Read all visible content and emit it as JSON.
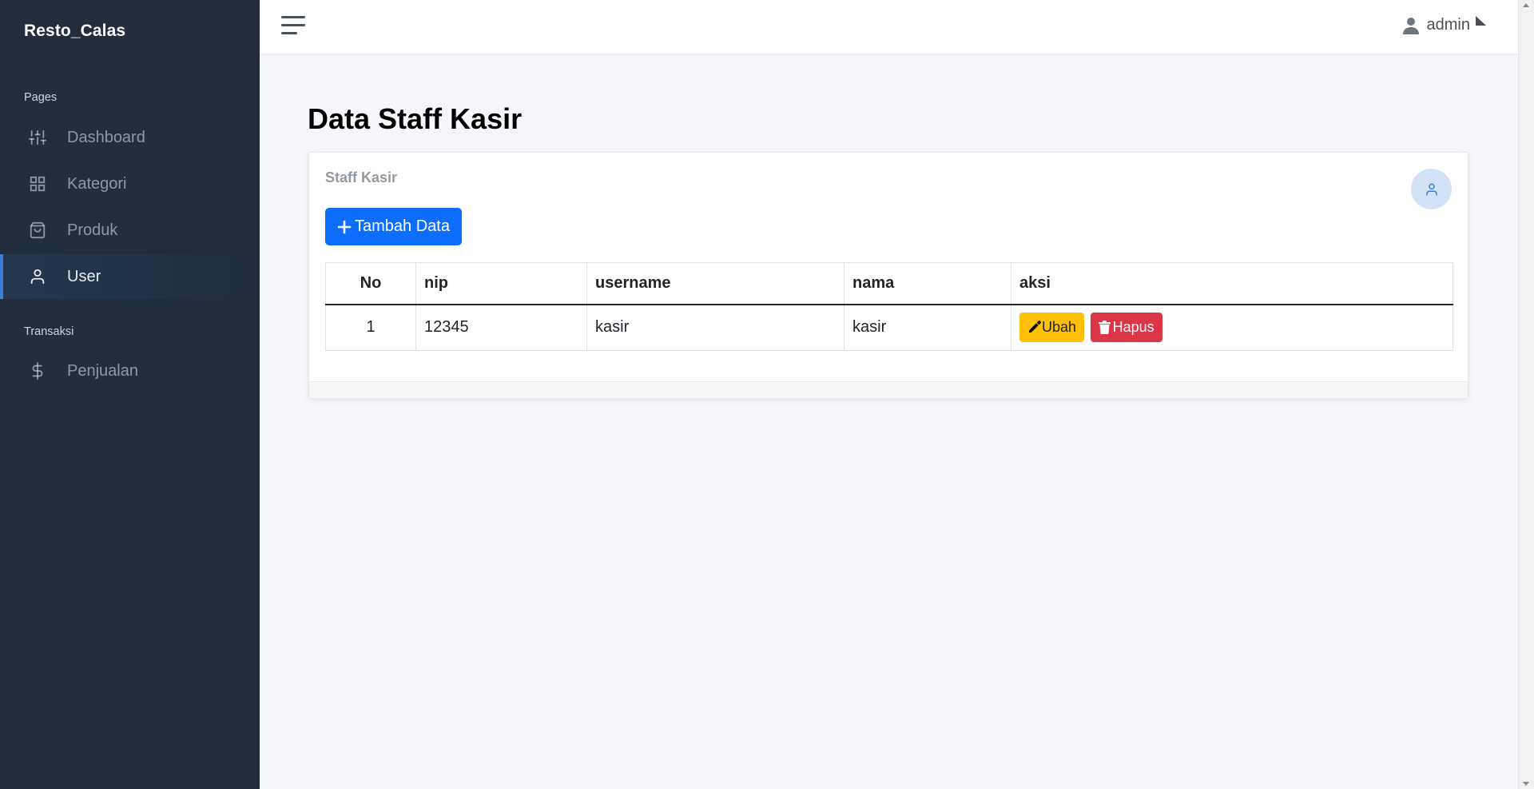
{
  "app": {
    "brand": "Resto_Calas"
  },
  "sidebar": {
    "sections": [
      {
        "header": "Pages"
      },
      {
        "header": "Transaksi"
      }
    ],
    "items": [
      {
        "label": "Dashboard",
        "icon": "sliders-icon",
        "active": false
      },
      {
        "label": "Kategori",
        "icon": "grid-icon",
        "active": false
      },
      {
        "label": "Produk",
        "icon": "shopping-bag-icon",
        "active": false
      },
      {
        "label": "User",
        "icon": "user-icon",
        "active": true
      },
      {
        "label": "Penjualan",
        "icon": "dollar-sign-icon",
        "active": false
      }
    ]
  },
  "topbar": {
    "user_name": "admin"
  },
  "page": {
    "title_bold": "Data",
    "title_rest": "Staff Kasir"
  },
  "card": {
    "title": "Staff Kasir",
    "add_button": "Tambah Data",
    "table": {
      "columns": [
        "No",
        "nip",
        "username",
        "nama",
        "aksi"
      ],
      "rows": [
        {
          "no": "1",
          "nip": "12345",
          "username": "kasir",
          "nama": "kasir",
          "edit_label": "Ubah",
          "delete_label": "Hapus"
        }
      ]
    }
  },
  "colors": {
    "sidebar_bg": "#222e3c",
    "accent": "#3b7ddd",
    "primary_button": "#0d6efd",
    "warning_button": "#ffc107",
    "danger_button": "#dc3545"
  }
}
